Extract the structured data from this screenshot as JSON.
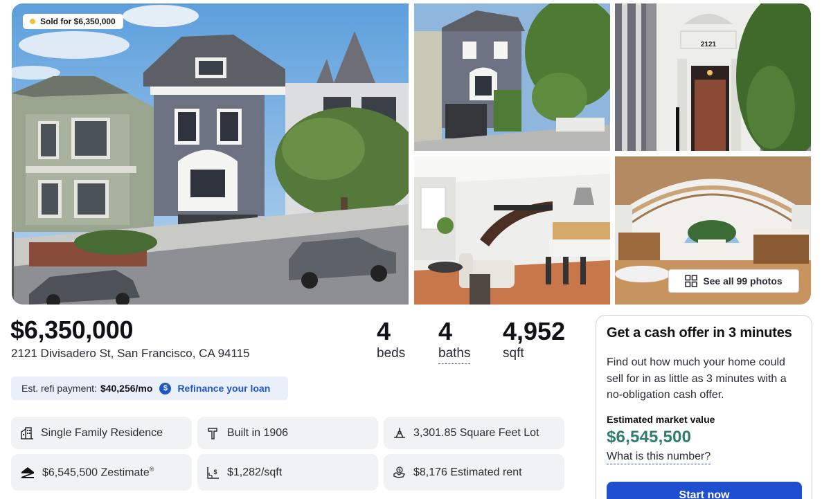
{
  "gallery": {
    "sold_badge": "Sold for $6,350,000",
    "see_all": "See all 99 photos",
    "house_number_plate": "2121"
  },
  "listing": {
    "price": "$6,350,000",
    "address": "2121 Divisadero St, San Francisco, CA 94115",
    "beds": {
      "value": "4",
      "label": "beds"
    },
    "baths": {
      "value": "4",
      "label": "baths"
    },
    "sqft": {
      "value": "4,952",
      "label": "sqft"
    }
  },
  "refi": {
    "label": "Est. refi payment:",
    "amount": "$40,256/mo",
    "coin": "$",
    "link": "Refinance your loan"
  },
  "facts": {
    "type": "Single Family Residence",
    "built": "Built in 1906",
    "lot": "3,301.85 Square Feet Lot",
    "zestimate": "$6,545,500 Zestimate",
    "zestimate_mark": "®",
    "price_per_sqft": "$1,282/sqft",
    "rent": "$8,176 Estimated rent"
  },
  "cash_offer": {
    "title": "Get a cash offer in 3 minutes",
    "description": "Find out how much your home could sell for in as little as 3 minutes with a no-obligation cash offer.",
    "market_value_label": "Estimated market value",
    "market_value": "$6,545,500",
    "what_link": "What is this number?",
    "start_button": "Start now"
  },
  "colors": {
    "accent_blue": "#1f4fd0",
    "market_value_green": "#2e7d6e",
    "refi_bg": "#e9f0f9",
    "tile_bg": "#f1f2f4",
    "badge_dot": "#f2c23d"
  },
  "icons": {
    "house_type": "building-icon",
    "built": "hammer-icon",
    "lot": "lot-measure-icon",
    "zestimate": "zillow-logo-icon",
    "price_per_sqft": "price-per-area-icon",
    "rent": "hand-dollar-icon",
    "see_all": "grid-icon"
  }
}
